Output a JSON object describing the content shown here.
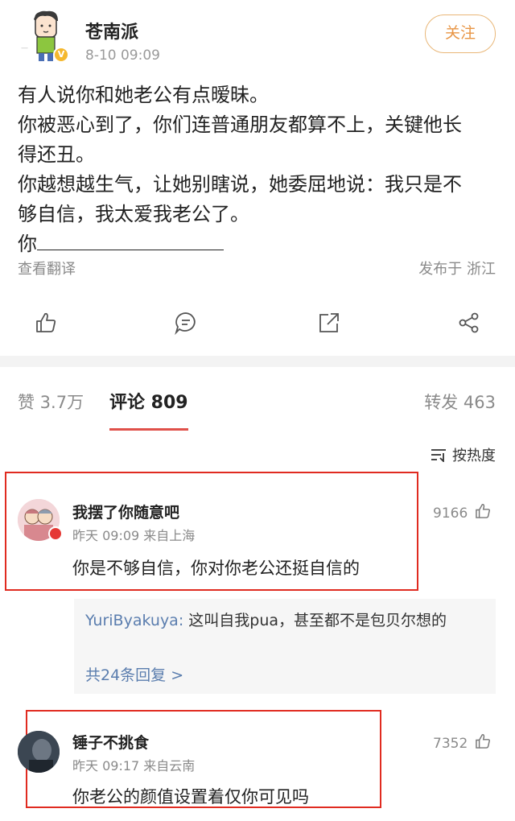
{
  "post": {
    "author": "苍南派",
    "time": "8-10 09:09",
    "follow_label": "关注",
    "lines": [
      "有人说你和她老公有点暧昧。",
      "你被恶心到了，你们连普通朋友都算不上，关键他长",
      "得还丑。",
      "你越想越生气，让她别瞎说，她委屈地说：我只是不",
      "够自信，我太爱我老公了。"
    ],
    "blank_prefix": "你",
    "translate_label": "查看翻译",
    "location": "发布于 浙江"
  },
  "actions": [
    "like-icon",
    "comment-icon",
    "share-icon",
    "more-share-icon"
  ],
  "tabs": {
    "like": "赞 3.7万",
    "comments": "评论 809",
    "repost": "转发 463"
  },
  "sort_label": "按热度",
  "comments": [
    {
      "name": "我摆了你随意吧",
      "meta": "昨天 09:09   来自上海",
      "text": "你是不够自信，你对你老公还挺自信的",
      "likes": "9166"
    },
    {
      "name": "锤子不挑食",
      "meta": "昨天 09:17   来自云南",
      "text": "你老公的颜值设置着仅你可见吗",
      "likes": "7352"
    }
  ],
  "reply": {
    "user": "YuriByakuya:",
    "text": " 这叫自我pua，甚至都不是包贝尔想的",
    "more": "共24条回复 >"
  },
  "colors": {
    "accent_red": "#e0504a",
    "follow_orange": "#e89544",
    "highlight_box": "#e02b20",
    "link_blue": "#5a7dae"
  }
}
